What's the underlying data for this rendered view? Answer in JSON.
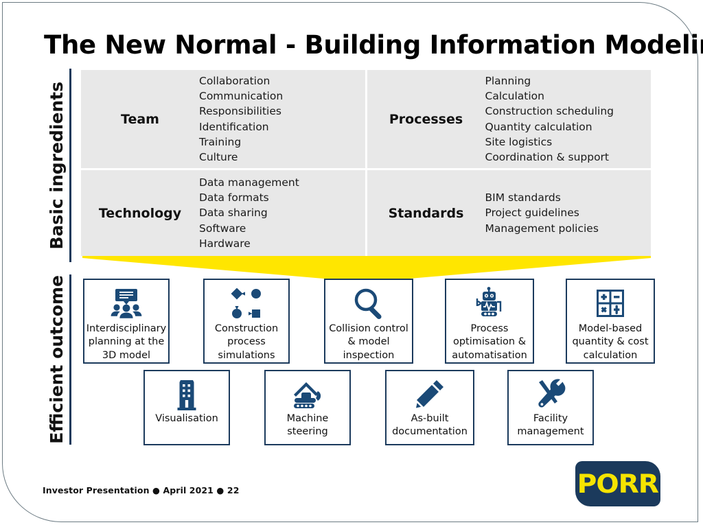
{
  "slide": {
    "title": "The New Normal - Building Information Modeling",
    "accent_yellow": "#ffe600",
    "accent_navy": "#1b3a5c",
    "cell_background": "#e8e8e8"
  },
  "sections": {
    "ingredients_label": "Basic ingredients",
    "outcome_label": "Efficient outcome"
  },
  "ingredients": [
    {
      "title": "Team",
      "items": [
        "Collaboration",
        "Communication",
        "Responsibilities",
        "Identification",
        "Training",
        "Culture"
      ]
    },
    {
      "title": "Processes",
      "items": [
        "Planning",
        "Calculation",
        "Construction scheduling",
        "Quantity calculation",
        "Site logistics",
        "Coordination & support"
      ]
    },
    {
      "title": "Technology",
      "items": [
        "Data management",
        "Data formats",
        "Data sharing",
        "Software",
        "Hardware"
      ]
    },
    {
      "title": "Standards",
      "items": [
        "BIM standards",
        "Project guidelines",
        "Management policies"
      ]
    }
  ],
  "outcomes_row1": [
    {
      "icon": "meeting-presentation-icon",
      "lines": [
        "Interdisciplinary",
        "planning at the",
        "3D model"
      ]
    },
    {
      "icon": "process-flow-diagram-icon",
      "lines": [
        "Construction",
        "process",
        "simulations"
      ]
    },
    {
      "icon": "magnifier-icon",
      "lines": [
        "Collision control",
        "& model",
        "inspection"
      ]
    },
    {
      "icon": "robot-icon",
      "lines": [
        "Process",
        "optimisation &",
        "automatisation"
      ]
    },
    {
      "icon": "calculator-icon",
      "lines": [
        "Model-based",
        "quantity & cost",
        "calculation"
      ]
    }
  ],
  "outcomes_row2": [
    {
      "icon": "building-icon",
      "lines": [
        "Visualisation"
      ]
    },
    {
      "icon": "excavator-icon",
      "lines": [
        "Machine",
        "steering"
      ]
    },
    {
      "icon": "pencil-icon",
      "lines": [
        "As-built",
        "documentation"
      ]
    },
    {
      "icon": "wrench-screwdriver-icon",
      "lines": [
        "Facility",
        "management"
      ]
    }
  ],
  "footer": {
    "text": "Investor Presentation ● April 2021 ●  22",
    "logo_text": "PORR"
  }
}
